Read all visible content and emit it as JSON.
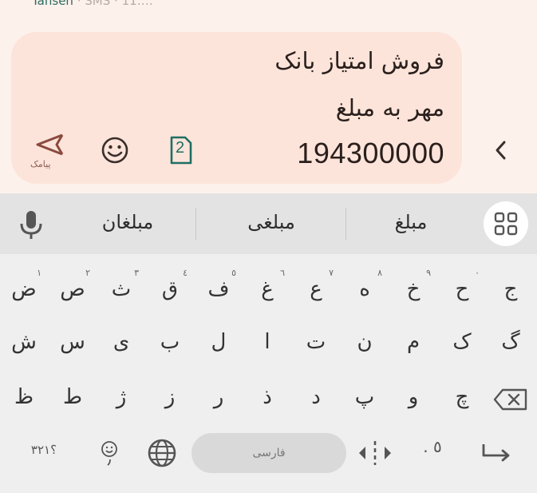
{
  "status": {
    "carrier": "Tansen",
    "sep": "·",
    "type": "SMS",
    "time": "11:…"
  },
  "message": {
    "line1": "فروش امتیاز بانک",
    "line2": "مهر به مبلغ",
    "line3": "194300000"
  },
  "composer": {
    "send_label": "پیامک",
    "sim_number": "2"
  },
  "suggestions": [
    "مبلغ",
    "مبلغی",
    "مبلغان"
  ],
  "keyboard": {
    "row1": [
      {
        "ch": "ج",
        "hint": ""
      },
      {
        "ch": "ح",
        "hint": "٠"
      },
      {
        "ch": "خ",
        "hint": "٩"
      },
      {
        "ch": "ه",
        "hint": "٨"
      },
      {
        "ch": "ع",
        "hint": "٧"
      },
      {
        "ch": "غ",
        "hint": "٦"
      },
      {
        "ch": "ف",
        "hint": "٥"
      },
      {
        "ch": "ق",
        "hint": "٤"
      },
      {
        "ch": "ث",
        "hint": "٣"
      },
      {
        "ch": "ص",
        "hint": "٢"
      },
      {
        "ch": "ض",
        "hint": "١"
      }
    ],
    "row2": [
      "گ",
      "ک",
      "م",
      "ن",
      "ت",
      "ا",
      "ل",
      "ب",
      "ی",
      "س",
      "ش"
    ],
    "row3": [
      "چ",
      "و",
      "پ",
      "د",
      "ذ",
      "ر",
      "ز",
      "ژ",
      "ط",
      "ظ"
    ],
    "space_label": "فارسی",
    "symbols_label": "؟۳۲۱",
    "period_label": ". ٥"
  }
}
